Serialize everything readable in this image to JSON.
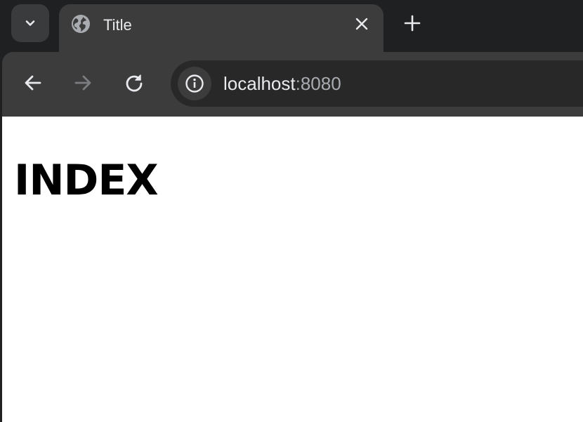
{
  "tab": {
    "title": "Title",
    "favicon": "globe-icon"
  },
  "tabstrip": {
    "tab_search_icon": "chevron-down-icon",
    "close_icon": "close-icon",
    "new_tab_icon": "plus-icon"
  },
  "toolbar": {
    "back_icon": "arrow-left-icon",
    "forward_icon": "arrow-right-icon",
    "reload_icon": "reload-icon",
    "site_info_icon": "info-icon",
    "url_host": "localhost",
    "url_port": ":8080"
  },
  "page": {
    "heading": "INDEX"
  },
  "colors": {
    "frame": "#1f2021",
    "toolbar": "#3c3c3c",
    "omnibox": "#282828",
    "content_bg": "#ffffff"
  }
}
